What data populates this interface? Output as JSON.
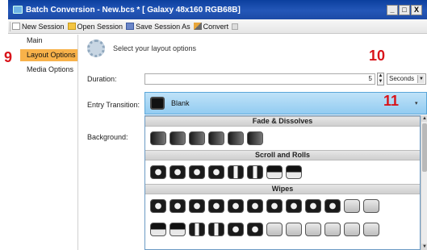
{
  "window": {
    "title": "Batch Conversion - New.bcs * [ Galaxy 48x160 RGB68B]",
    "controls": {
      "minimize": "_",
      "maximize": "□",
      "close": "X"
    }
  },
  "toolbar": {
    "new_session": "New Session",
    "open_session": "Open Session",
    "save_session_as": "Save Session As",
    "convert": "Convert"
  },
  "sidebar": {
    "items": [
      {
        "label": "Main",
        "active": false
      },
      {
        "label": "Layout Options",
        "active": true
      },
      {
        "label": "Media Options",
        "active": false
      }
    ]
  },
  "main": {
    "header": "Select your layout options",
    "duration": {
      "label": "Duration:",
      "value": "5",
      "unit": "Seconds"
    },
    "entry_transition": {
      "label": "Entry Transition:",
      "value": "Blank"
    },
    "background": {
      "label": "Background:"
    }
  },
  "transitions": {
    "groups": [
      {
        "name": "Fade & Dissolves",
        "tiles": 6
      },
      {
        "name": "Scroll and Rolls",
        "tiles": 8
      },
      {
        "name": "Wipes",
        "tiles": 20
      }
    ]
  },
  "callouts": {
    "nine": "9",
    "ten": "10",
    "eleven": "11"
  },
  "colors": {
    "title_bar": "#1c4aa6",
    "active_tab": "#f8b24a",
    "entry_highlight": "#93ccf1",
    "callout": "#d9141a"
  }
}
